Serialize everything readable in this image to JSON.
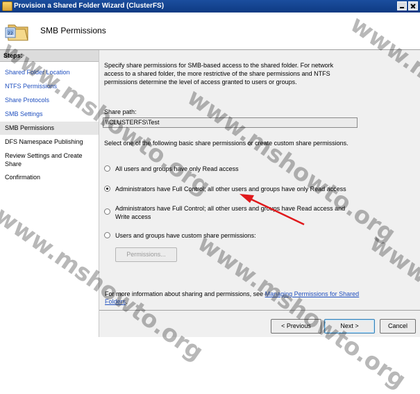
{
  "window": {
    "title": "Provision a Shared Folder Wizard (ClusterFS)"
  },
  "header": {
    "title": "SMB Permissions"
  },
  "steps": {
    "heading": "Steps:",
    "items": [
      {
        "label": "Shared Folder Location"
      },
      {
        "label": "NTFS Permissions"
      },
      {
        "label": "Share Protocols"
      },
      {
        "label": "SMB Settings"
      },
      {
        "label": "SMB Permissions"
      },
      {
        "label": "DFS Namespace Publishing"
      },
      {
        "label": "Review Settings and Create Share"
      },
      {
        "label": "Confirmation"
      }
    ]
  },
  "main": {
    "intro": "Specify share permissions for SMB-based access to the shared folder. For network access to a shared folder, the more restrictive of the share permissions and NTFS permissions determine the level of access granted to users or groups.",
    "share_path_label": "Share path:",
    "share_path_value": "\\\\CLUSTERFS\\Test",
    "select_text": "Select one of the following basic share permissions or create custom share permissions.",
    "options": [
      {
        "label": "All users and groups have only Read access",
        "checked": false
      },
      {
        "label": "Administrators have Full Control; all other users and groups have only Read access",
        "checked": true
      },
      {
        "label": "Administrators have Full Control; all other users and groups have Read access and Write access",
        "checked": false
      },
      {
        "label": "Users and groups have custom share permissions:",
        "checked": false
      }
    ],
    "permissions_button": "Permissions...",
    "info_text": "For more information about sharing and permissions, see ",
    "info_link": "Managing Permissions for Shared Folders",
    "info_end": "."
  },
  "footer": {
    "previous": "< Previous",
    "next": "Next >",
    "cancel": "Cancel"
  },
  "watermark": "www.mshowto.org"
}
